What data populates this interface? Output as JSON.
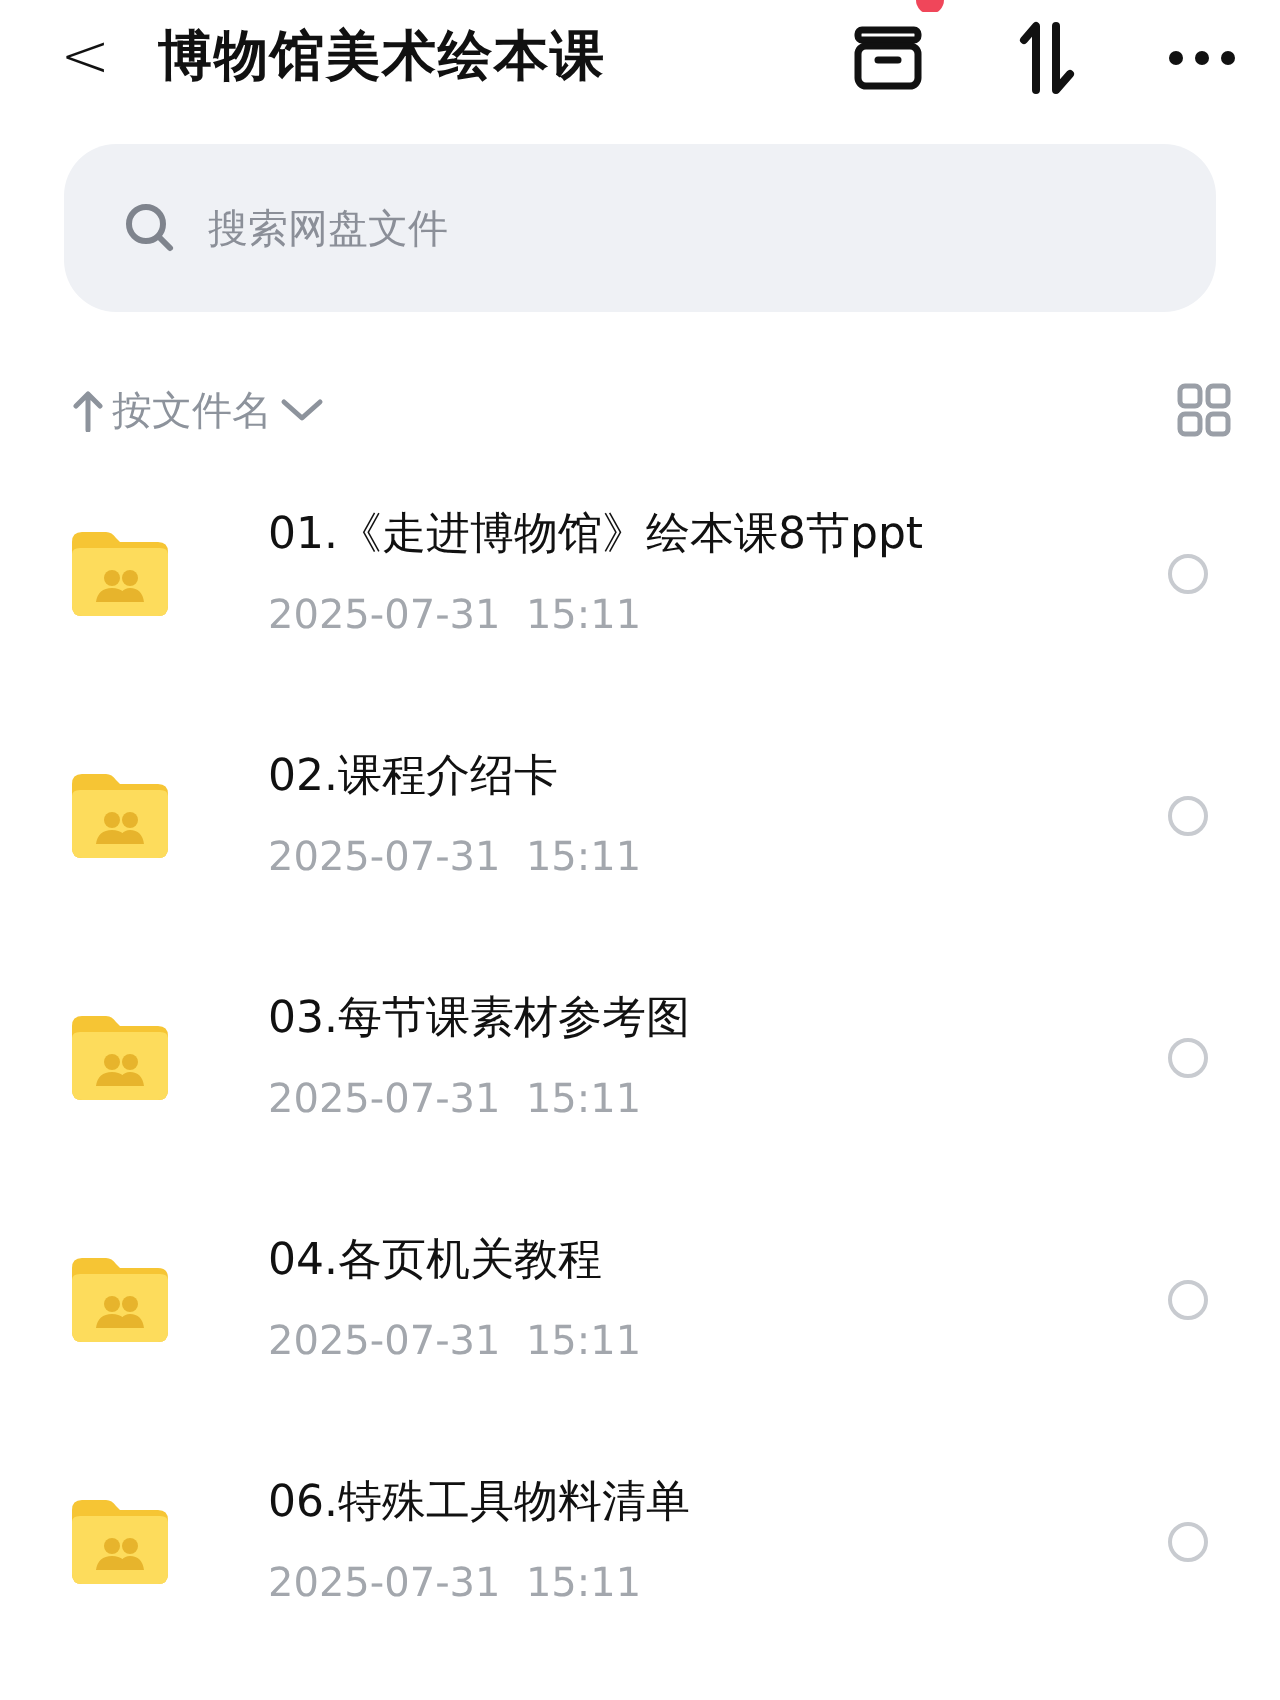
{
  "header": {
    "back": "<",
    "title": "博物馆美术绘本课"
  },
  "search": {
    "placeholder": "搜索网盘文件"
  },
  "sort": {
    "label": "按文件名"
  },
  "files": [
    {
      "name": "01.《走进博物馆》绘本课8节ppt",
      "modified": "2025-07-31  15:11",
      "selected": false
    },
    {
      "name": "02.课程介绍卡",
      "modified": "2025-07-31  15:11",
      "selected": false
    },
    {
      "name": "03.每节课素材参考图",
      "modified": "2025-07-31  15:11",
      "selected": false
    },
    {
      "name": "04.各页机关教程",
      "modified": "2025-07-31  15:11",
      "selected": false
    },
    {
      "name": "06.特殊工具物料清单",
      "modified": "2025-07-31  15:11",
      "selected": false
    }
  ]
}
